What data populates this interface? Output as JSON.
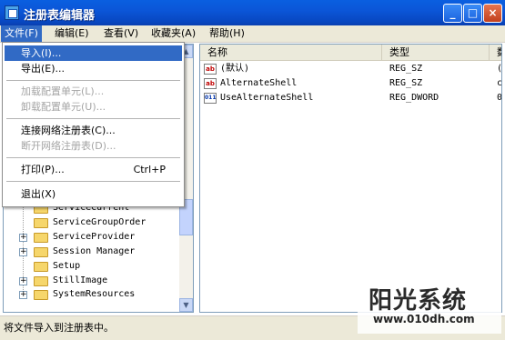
{
  "window": {
    "title": "注册表编辑器",
    "buttons": {
      "minimize": "_",
      "maximize": "□",
      "close": "×"
    }
  },
  "menubar": {
    "items": [
      {
        "label": "文件(F)"
      },
      {
        "label": "编辑(E)"
      },
      {
        "label": "查看(V)"
      },
      {
        "label": "收藏夹(A)"
      },
      {
        "label": "帮助(H)"
      }
    ]
  },
  "file_menu": {
    "items": [
      {
        "label": "导入(I)...",
        "state": "highlighted"
      },
      {
        "label": "导出(E)...",
        "state": "enabled"
      },
      {
        "label": "加载配置单元(L)...",
        "state": "disabled"
      },
      {
        "label": "卸载配置单元(U)...",
        "state": "disabled"
      },
      {
        "label": "连接网络注册表(C)...",
        "state": "enabled"
      },
      {
        "label": "断开网络注册表(D)...",
        "state": "disabled"
      },
      {
        "label": "打印(P)...",
        "shortcut": "Ctrl+P",
        "state": "enabled"
      },
      {
        "label": "退出(X)",
        "state": "enabled"
      }
    ]
  },
  "tree": {
    "items": [
      {
        "label": "ServiceCurrent",
        "expander": ""
      },
      {
        "label": "ServiceGroupOrder",
        "expander": ""
      },
      {
        "label": "ServiceProvider",
        "expander": "+"
      },
      {
        "label": "Session Manager",
        "expander": "+"
      },
      {
        "label": "Setup",
        "expander": ""
      },
      {
        "label": "StillImage",
        "expander": "+"
      },
      {
        "label": "SystemResources",
        "expander": "+"
      }
    ]
  },
  "list": {
    "columns": [
      "名称",
      "类型",
      "数"
    ],
    "rows": [
      {
        "name": "(默认)",
        "type": "REG_SZ",
        "data": "(",
        "icon": "string-value-icon",
        "icon_text": "ab"
      },
      {
        "name": "AlternateShell",
        "type": "REG_SZ",
        "data": "c",
        "icon": "string-value-icon",
        "icon_text": "ab"
      },
      {
        "name": "UseAlternateShell",
        "type": "REG_DWORD",
        "data": "0:",
        "icon": "binary-value-icon",
        "icon_text": "011"
      }
    ]
  },
  "statusbar": {
    "text": "将文件导入到注册表中。"
  },
  "watermark": {
    "main": "阳光系统",
    "sub": "www.010dh.com"
  },
  "colors": {
    "title_bar": "#0a5fe0",
    "menu_highlight": "#316ac5",
    "chrome": "#ece9d8"
  }
}
